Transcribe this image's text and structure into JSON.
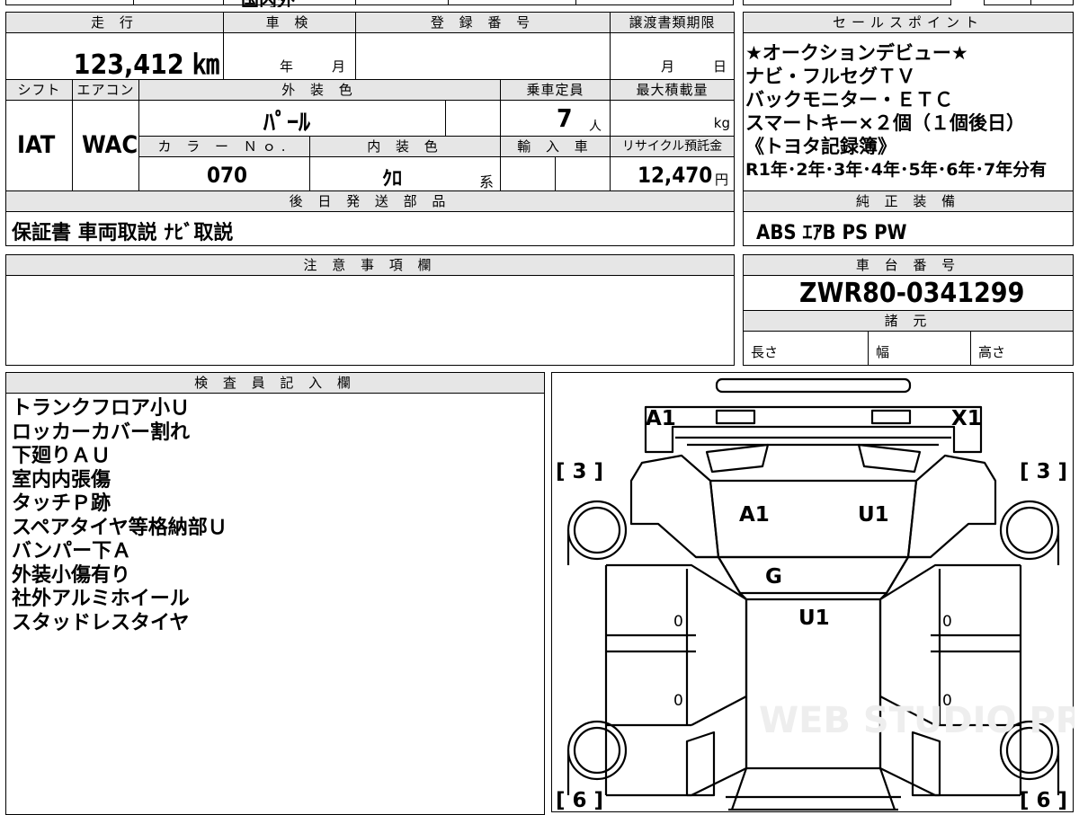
{
  "top_strip": {
    "partial_text": "国内外"
  },
  "headers": {
    "mileage": "走 行",
    "inspection": "車 検",
    "registration": "登 録 番 号",
    "transfer_deadline": "譲渡書類期限",
    "sales_point": "セールスポイント",
    "shift": "シフト",
    "aircon": "エアコン",
    "exterior_color": "外 装 色",
    "capacity": "乗車定員",
    "max_load": "最大積載量",
    "color_no": "カ ラ ー Ｎｏ.",
    "interior_color": "内 装 色",
    "import": "輸 入 車",
    "recycle": "リサイクル預託金",
    "later_parts": "後 日 発 送 部 品",
    "genuine_equipment": "純 正 装 備",
    "caution": "注 意 事 項 欄",
    "chassis_no": "車 台 番 号",
    "specs": "諸 元",
    "inspector": "検 査 員 記 入 欄"
  },
  "values": {
    "mileage": "123,412 ㎞",
    "inspection_year_unit": "年",
    "inspection_month_unit": "月",
    "deadline_month_unit": "月",
    "deadline_day_unit": "日",
    "shift": "IAT",
    "aircon": "WAC",
    "exterior_color": "ﾊﾟｰﾙ",
    "capacity": "7",
    "capacity_unit": "人",
    "max_load_unit": "kg",
    "color_no": "070",
    "interior_color": "ｸﾛ",
    "interior_suffix": "系",
    "recycle_fee": "12,470",
    "recycle_unit": "円",
    "later_parts": "保証書 車両取説 ﾅﾋﾞ取説",
    "genuine_equipment": "ABS ｴｱB PS PW",
    "chassis_no": "ZWR80-0341299",
    "spec_length": "長さ",
    "spec_width": "幅",
    "spec_height": "高さ"
  },
  "sales_points": [
    "★オークションデビュー★",
    "ナビ・フルセグＴＶ",
    "バックモニター・ＥＴＣ",
    "スマートキー×２個（１個後日）",
    "《トヨタ記録簿》",
    "R1年･2年･3年･4年･5年･6年･7年分有"
  ],
  "inspector_notes": [
    "トランクフロア小Ｕ",
    "ロッカーカバー割れ",
    "下廻りＡＵ",
    "室内内張傷",
    "タッチＰ跡",
    "スペアタイヤ等格納部Ｕ",
    "バンパー下Ａ",
    "外装小傷有り",
    "社外アルミホイール",
    "スタッドレスタイヤ"
  ],
  "diagram": {
    "front_left": "A1",
    "front_right": "X1",
    "hood_left": "A1",
    "hood_right": "U1",
    "windshield": "G",
    "roof": "U1",
    "front_left_tire": "[ 3 ]",
    "front_right_tire": "[ 3 ]",
    "rear_left_tire": "[ 6 ]",
    "rear_right_tire": "[ 6 ]",
    "left_front_door": "0",
    "left_rear_door": "0",
    "right_front_door": "0",
    "right_rear_door": "0"
  },
  "watermark": "WEB STUDIO PRO"
}
